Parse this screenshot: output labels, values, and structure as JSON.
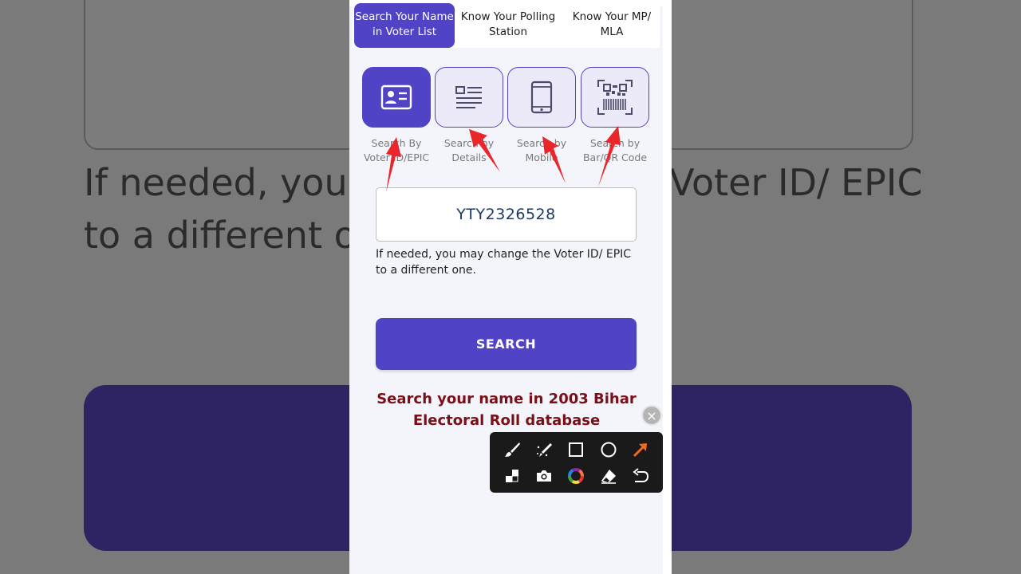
{
  "background": {
    "text": "If needed, you may change the Voter ID/ EPIC to a different one."
  },
  "tabs": [
    {
      "label": "Search Your Name in Voter List",
      "active": true
    },
    {
      "label": "Know Your Polling Station",
      "active": false
    },
    {
      "label": "Know Your MP/ MLA",
      "active": false
    }
  ],
  "search_options": [
    {
      "label": "Search By Voter ID/EPIC",
      "icon": "id-card-icon",
      "active": true
    },
    {
      "label": "Search by Details",
      "icon": "document-lines-icon",
      "active": false
    },
    {
      "label": "Search by Mobile",
      "icon": "mobile-phone-icon",
      "active": false
    },
    {
      "label": "Search by Bar/QR Code",
      "icon": "qr-barcode-icon",
      "active": false
    }
  ],
  "epic_input": {
    "value": "YTY2326528"
  },
  "hint": "If needed, you may change the Voter ID/ EPIC to a different one.",
  "search_button": {
    "label": "SEARCH"
  },
  "bihar_link": "Search your name in 2003 Bihar Electoral Roll database",
  "toolbar": {
    "tools": [
      "brush-icon",
      "magic-pen-icon",
      "rectangle-icon",
      "circle-icon",
      "arrow-icon",
      "mosaic-icon",
      "camera-icon",
      "color-wheel-icon",
      "eraser-icon",
      "undo-icon"
    ],
    "close": "×"
  },
  "colors": {
    "primary": "#5143c5",
    "tile_bg": "#ece9f8",
    "link_red": "#7b0f17",
    "annotation_red": "#e8262c",
    "arrow_tool_orange": "#f26b1d"
  }
}
